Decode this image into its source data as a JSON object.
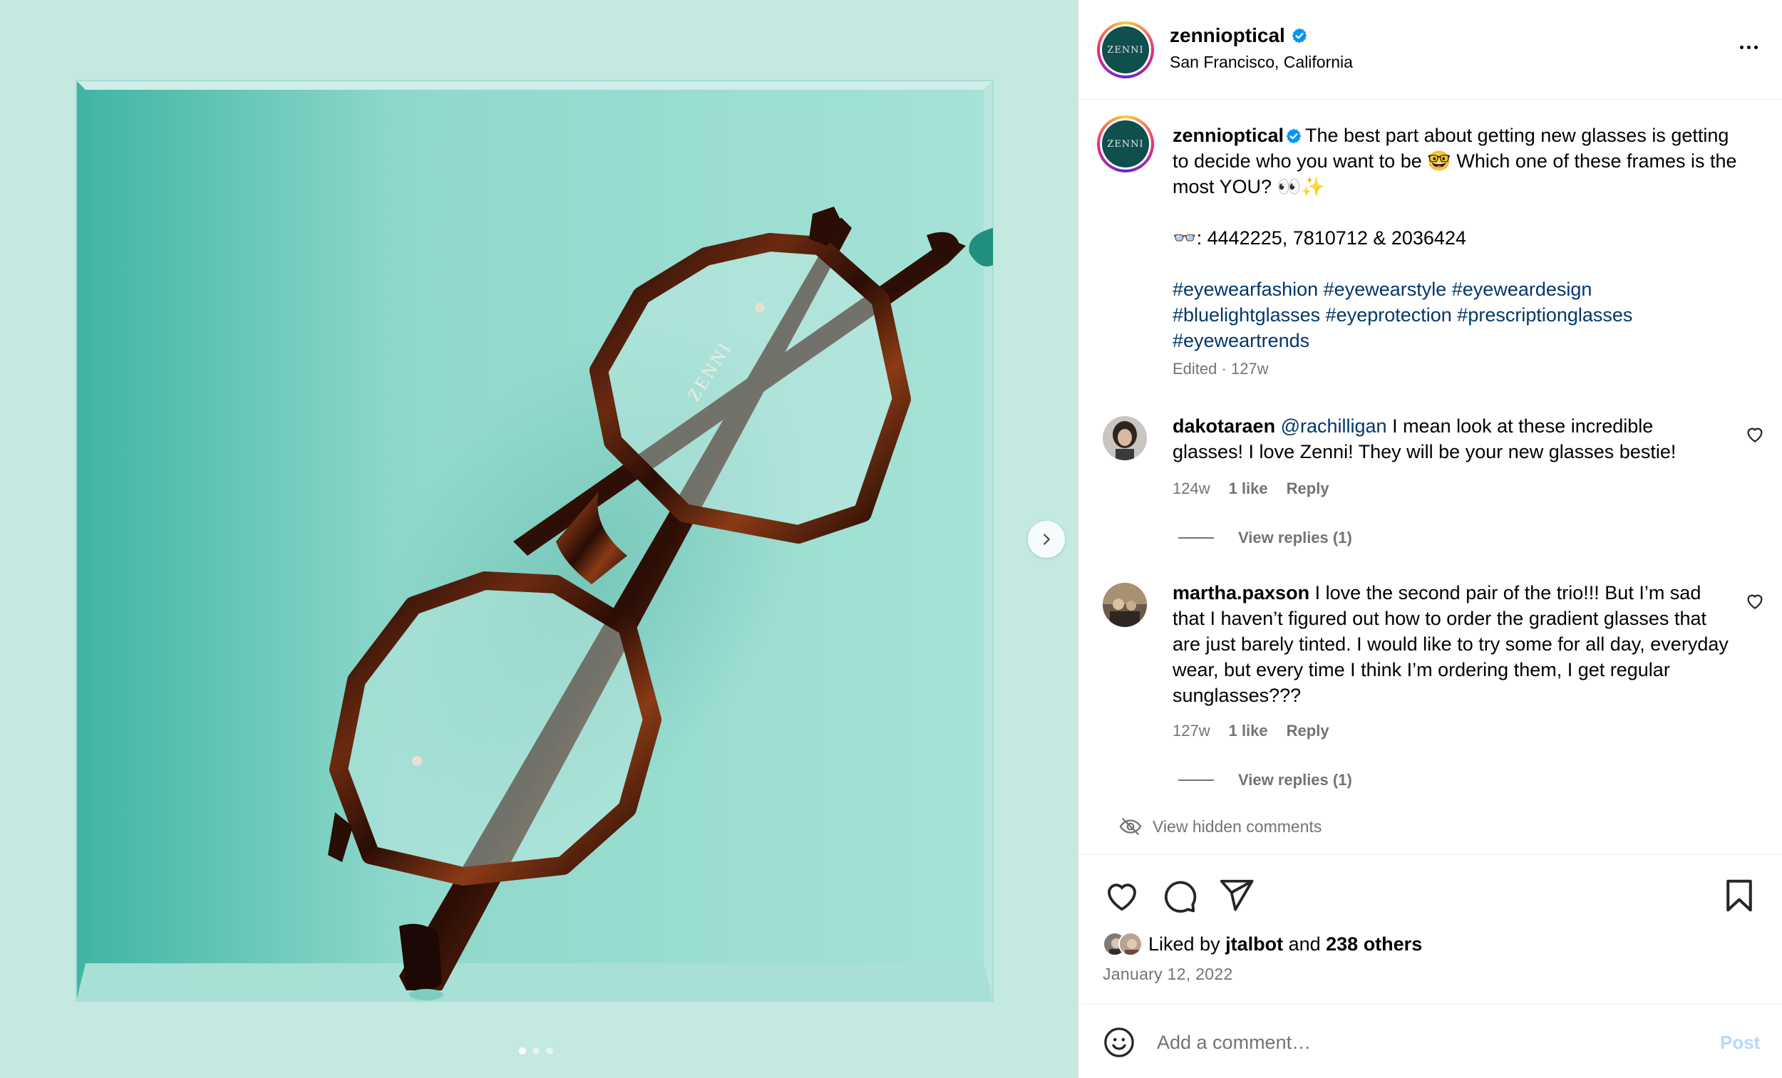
{
  "header": {
    "avatar_text": "ZENNI",
    "username": "zennioptical",
    "location": "San Francisco, California"
  },
  "caption": {
    "username": "zennioptical",
    "line1": "The best part about getting new glasses is getting to decide who you want to be 🤓 Which one of these frames is the most YOU? 👀✨",
    "frames": "👓: 4442225, 7810712 & 2036424",
    "hashtags": [
      "#eyewearfashion",
      "#eyewearstyle",
      "#eyeweardesign",
      "#bluelightglasses",
      "#eyeprotection",
      "#prescriptionglasses",
      "#eyeweartrends"
    ],
    "edited": "Edited",
    "sep": " · ",
    "age": "127w"
  },
  "comments": [
    {
      "username": "dakotaraen",
      "mention": "@rachilligan",
      "text": " I mean look at these incredible glasses! I love Zenni! They will be your new glasses bestie!",
      "age": "124w",
      "likes": "1 like",
      "reply": "Reply",
      "view_replies": "View replies (1)"
    },
    {
      "username": "martha.paxson",
      "text": " I love the second pair of the trio!!! But I’m sad that I haven’t figured out how to order the gradient glasses that are just barely tinted. I would like to try some for all day, everyday wear, but every time I think I’m ordering them, I get regular sunglasses???",
      "age": "127w",
      "likes": "1 like",
      "reply": "Reply",
      "view_replies": "View replies (1)"
    }
  ],
  "hidden_comments": "View hidden comments",
  "likes": {
    "prefix": "Liked by ",
    "user": "jtalbot",
    "middle": " and ",
    "others": "238 others"
  },
  "post_date": "January 12, 2022",
  "add_comment": {
    "placeholder": "Add a comment…",
    "post": "Post"
  },
  "media": {
    "frame_brand": "ZENNI",
    "carousel_count": 3,
    "carousel_active": 1
  },
  "colors": {
    "link": "#00376b",
    "muted": "#737373",
    "post_disabled": "#b3dbff",
    "verified": "#0095f6",
    "backdrop": "#bfe6dd",
    "box_inner": "#95dccf",
    "tortoise": "#3a1408"
  },
  "icons": [
    "verified-badge-icon",
    "more-options-icon",
    "chevron-right-icon",
    "heart-icon",
    "comment-icon",
    "share-icon",
    "bookmark-icon",
    "eye-off-icon",
    "emoji-icon"
  ]
}
